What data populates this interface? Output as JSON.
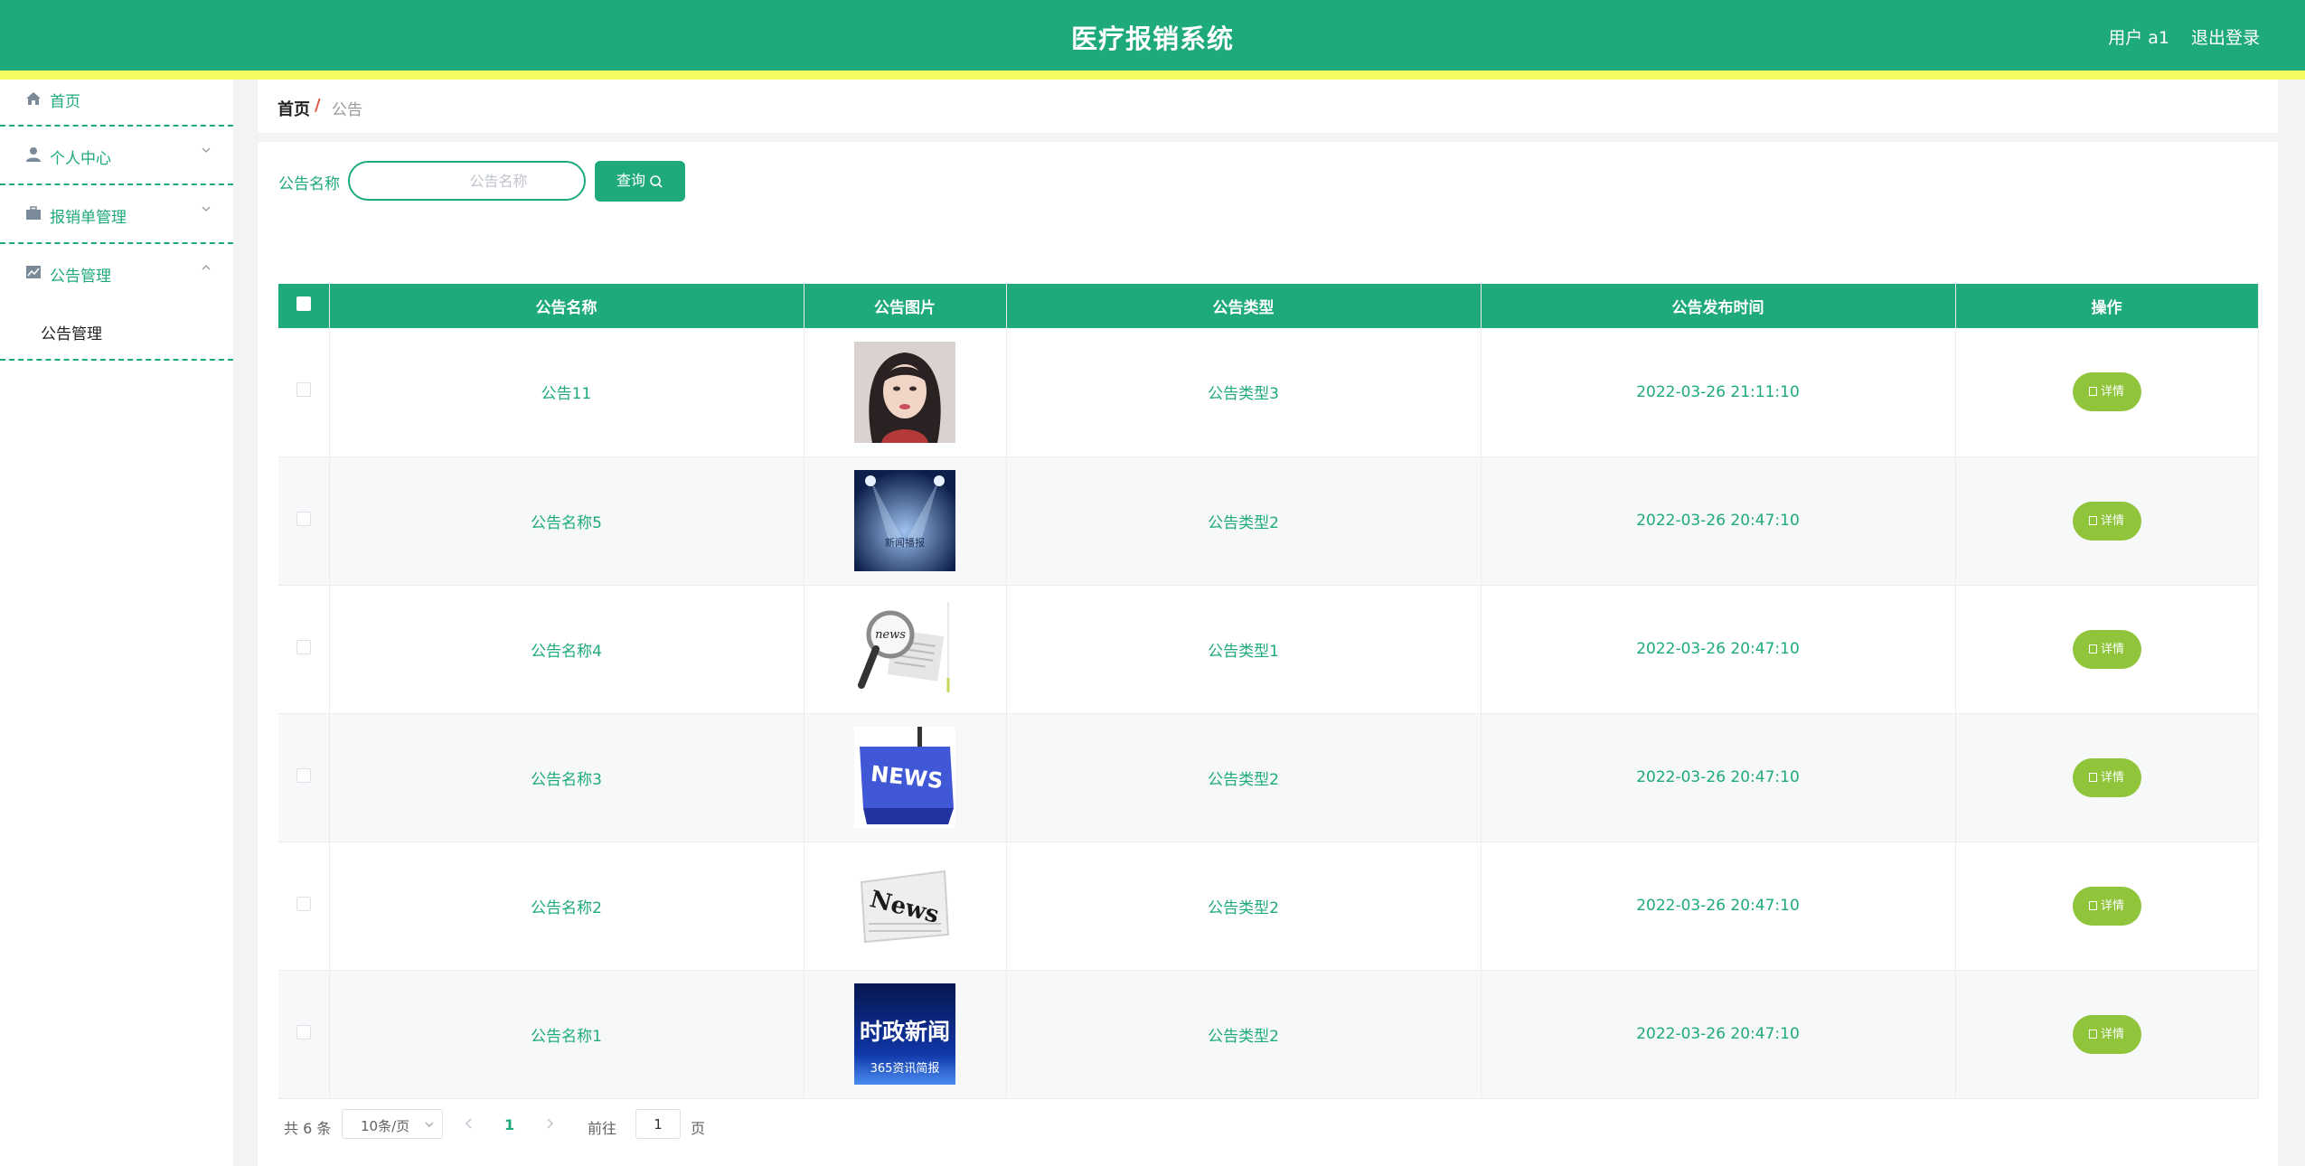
{
  "header": {
    "title": "医疗报销系统",
    "user_label": "用户 a1",
    "logout_label": "退出登录"
  },
  "sidebar": {
    "items": [
      {
        "label": "首页",
        "icon": "home-icon"
      },
      {
        "label": "个人中心",
        "icon": "user-icon"
      },
      {
        "label": "报销单管理",
        "icon": "briefcase-icon"
      },
      {
        "label": "公告管理",
        "icon": "chart-icon"
      }
    ],
    "submenu_label": "公告管理"
  },
  "breadcrumb": {
    "home": "首页",
    "separator": "/",
    "current": "公告"
  },
  "search": {
    "label": "公告名称",
    "placeholder": "公告名称",
    "button_label": "查询"
  },
  "table": {
    "columns": [
      "公告名称",
      "公告图片",
      "公告类型",
      "公告发布时间",
      "操作"
    ],
    "detail_label": "详情",
    "rows": [
      {
        "name": "公告11",
        "image": "portrait-photo",
        "type": "公告类型3",
        "time": "2022-03-26 21:11:10"
      },
      {
        "name": "公告名称5",
        "image": "stage-spotlight",
        "image_caption": "新闻播报",
        "type": "公告类型2",
        "time": "2022-03-26 20:47:10"
      },
      {
        "name": "公告名称4",
        "image": "magnifier-news",
        "image_caption": "news",
        "type": "公告类型1",
        "time": "2022-03-26 20:47:10"
      },
      {
        "name": "公告名称3",
        "image": "news-blue-sign",
        "image_caption": "NEWS",
        "type": "公告类型2",
        "time": "2022-03-26 20:47:10"
      },
      {
        "name": "公告名称2",
        "image": "newspaper-news",
        "image_caption": "News",
        "type": "公告类型2",
        "time": "2022-03-26 20:47:10"
      },
      {
        "name": "公告名称1",
        "image": "politics-news-banner",
        "image_caption": "时政新闻",
        "image_subcaption": "365资讯简报",
        "type": "公告类型2",
        "time": "2022-03-26 20:47:10"
      }
    ]
  },
  "pagination": {
    "total": "共 6 条",
    "page_size": "10条/页",
    "current_page": "1",
    "goto_label": "前往",
    "goto_value": "1",
    "page_suffix": "页"
  },
  "colors": {
    "primary": "#1eaa7a",
    "accent_stripe": "#f3fd62",
    "detail_button": "#8fc43b"
  }
}
